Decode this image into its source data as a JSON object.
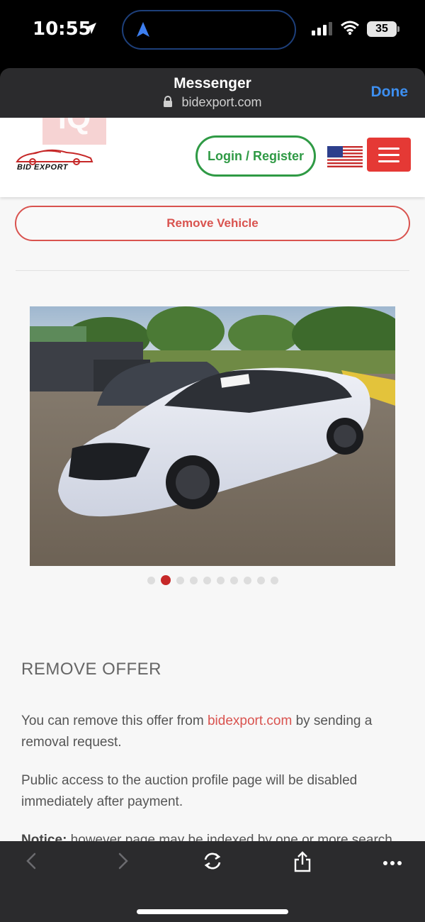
{
  "status_bar": {
    "time": "10:55",
    "battery": "35",
    "icons": [
      "location-arrow-icon",
      "navigation-icon",
      "signal-icon",
      "wifi-icon",
      "battery-icon"
    ]
  },
  "browser": {
    "title": "Messenger",
    "url": "bidexport.com",
    "done_label": "Done"
  },
  "site": {
    "watermark": "iQ",
    "logo_text": "BID EXPORT",
    "login_label": "Login / Register",
    "accent_green": "#2f9a45",
    "accent_red": "#e53935"
  },
  "vehicle": {
    "remove_label": "Remove Vehicle",
    "gallery": {
      "total_images": 10,
      "current_index": 2
    }
  },
  "remove_offer": {
    "heading": "REMOVE OFFER",
    "p1_before": "You can remove this offer from ",
    "p1_link": "bidexport.com",
    "p1_after": " by sending a removal request.",
    "p2": "Public access to the auction profile page will be disabled immediately after payment.",
    "p3_bold": "Notice:",
    "p3_text": " however page may be indexed by one or more search"
  },
  "toolbar": {
    "icons": [
      "back-icon",
      "forward-icon",
      "reload-icon",
      "share-icon",
      "more-icon"
    ]
  }
}
